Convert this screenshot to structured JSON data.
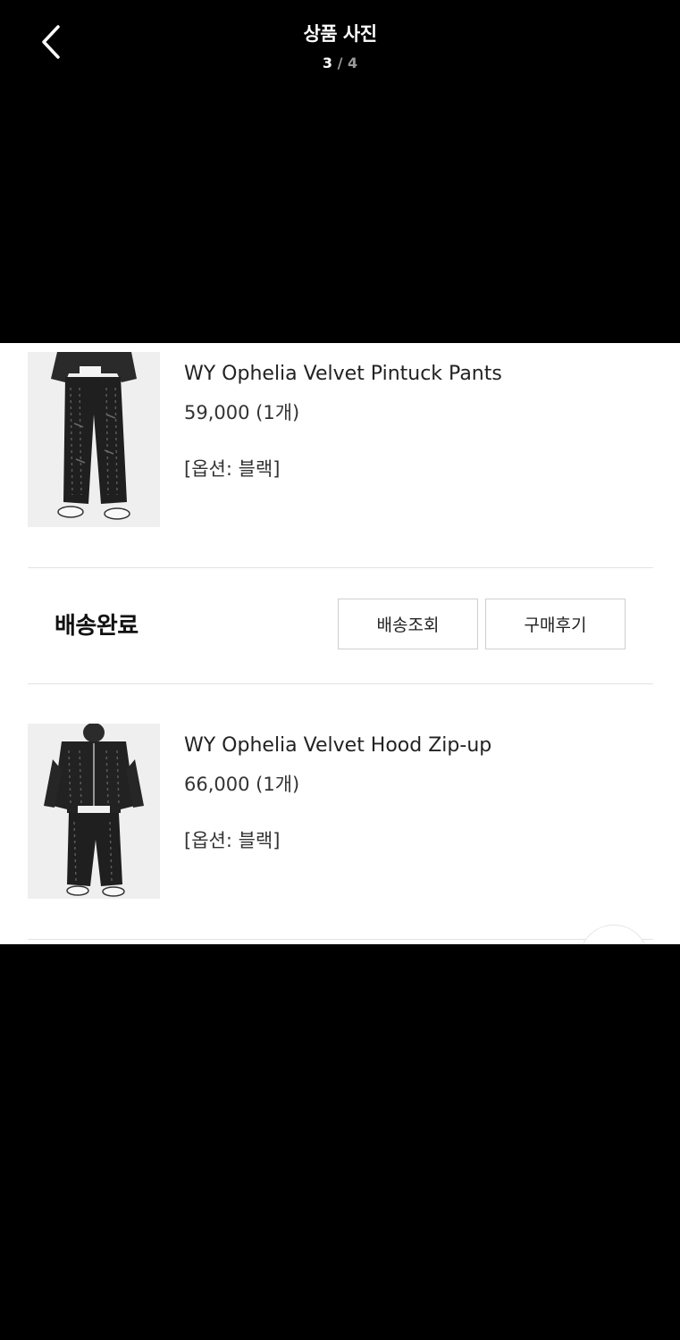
{
  "header": {
    "title": "상품 사진",
    "counter_current": "3",
    "counter_separator": "/",
    "counter_total": "4"
  },
  "items": [
    {
      "name": "WY Ophelia Velvet Pintuck Pants",
      "price": "59,000 (1개)",
      "option": "[옵션: 블랙]"
    },
    {
      "name": "WY Ophelia Velvet Hood Zip-up",
      "price": "66,000 (1개)",
      "option": "[옵션: 블랙]"
    }
  ],
  "order_status": {
    "label": "배송완료",
    "tracking_button": "배송조회",
    "review_button": "구매후기"
  },
  "icons": {
    "back": "chevron-left-icon"
  },
  "colors": {
    "background": "#000000",
    "header_text": "#ffffff",
    "counter_muted": "#9a9a9a",
    "photo_background": "#ffffff"
  }
}
